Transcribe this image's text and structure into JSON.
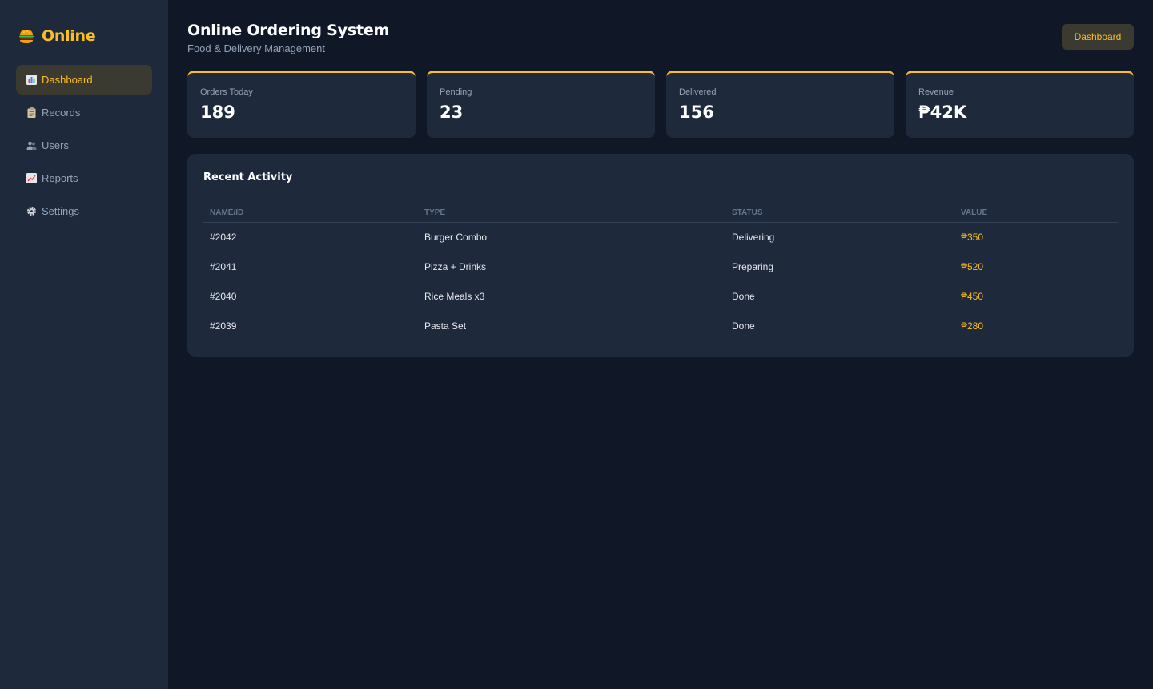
{
  "sidebar": {
    "brand": {
      "icon": "burger-icon",
      "name": "Online"
    },
    "items": [
      {
        "icon": "bar-chart-icon",
        "label": "Dashboard",
        "active": true
      },
      {
        "icon": "clipboard-icon",
        "label": "Records",
        "active": false
      },
      {
        "icon": "users-icon",
        "label": "Users",
        "active": false
      },
      {
        "icon": "trend-chart-icon",
        "label": "Reports",
        "active": false
      },
      {
        "icon": "gear-icon",
        "label": "Settings",
        "active": false
      }
    ]
  },
  "header": {
    "title": "Online Ordering System",
    "subtitle": "Food & Delivery Management",
    "button_label": "Dashboard"
  },
  "stats": [
    {
      "label": "Orders Today",
      "value": "189"
    },
    {
      "label": "Pending",
      "value": "23"
    },
    {
      "label": "Delivered",
      "value": "156"
    },
    {
      "label": "Revenue",
      "value": "₱42K"
    }
  ],
  "activity": {
    "title": "Recent Activity",
    "columns": [
      "Name/ID",
      "Type",
      "Status",
      "Value"
    ],
    "rows": [
      [
        "#2042",
        "Burger Combo",
        "Delivering",
        "₱350"
      ],
      [
        "#2041",
        "Pizza + Drinks",
        "Preparing",
        "₱520"
      ],
      [
        "#2040",
        "Rice Meals x3",
        "Done",
        "₱450"
      ],
      [
        "#2039",
        "Pasta Set",
        "Done",
        "₱280"
      ]
    ]
  },
  "colors": {
    "accent": "#fbbf24",
    "background": "#101828",
    "surface": "#1e293b",
    "muted_text": "#94a3b8"
  }
}
